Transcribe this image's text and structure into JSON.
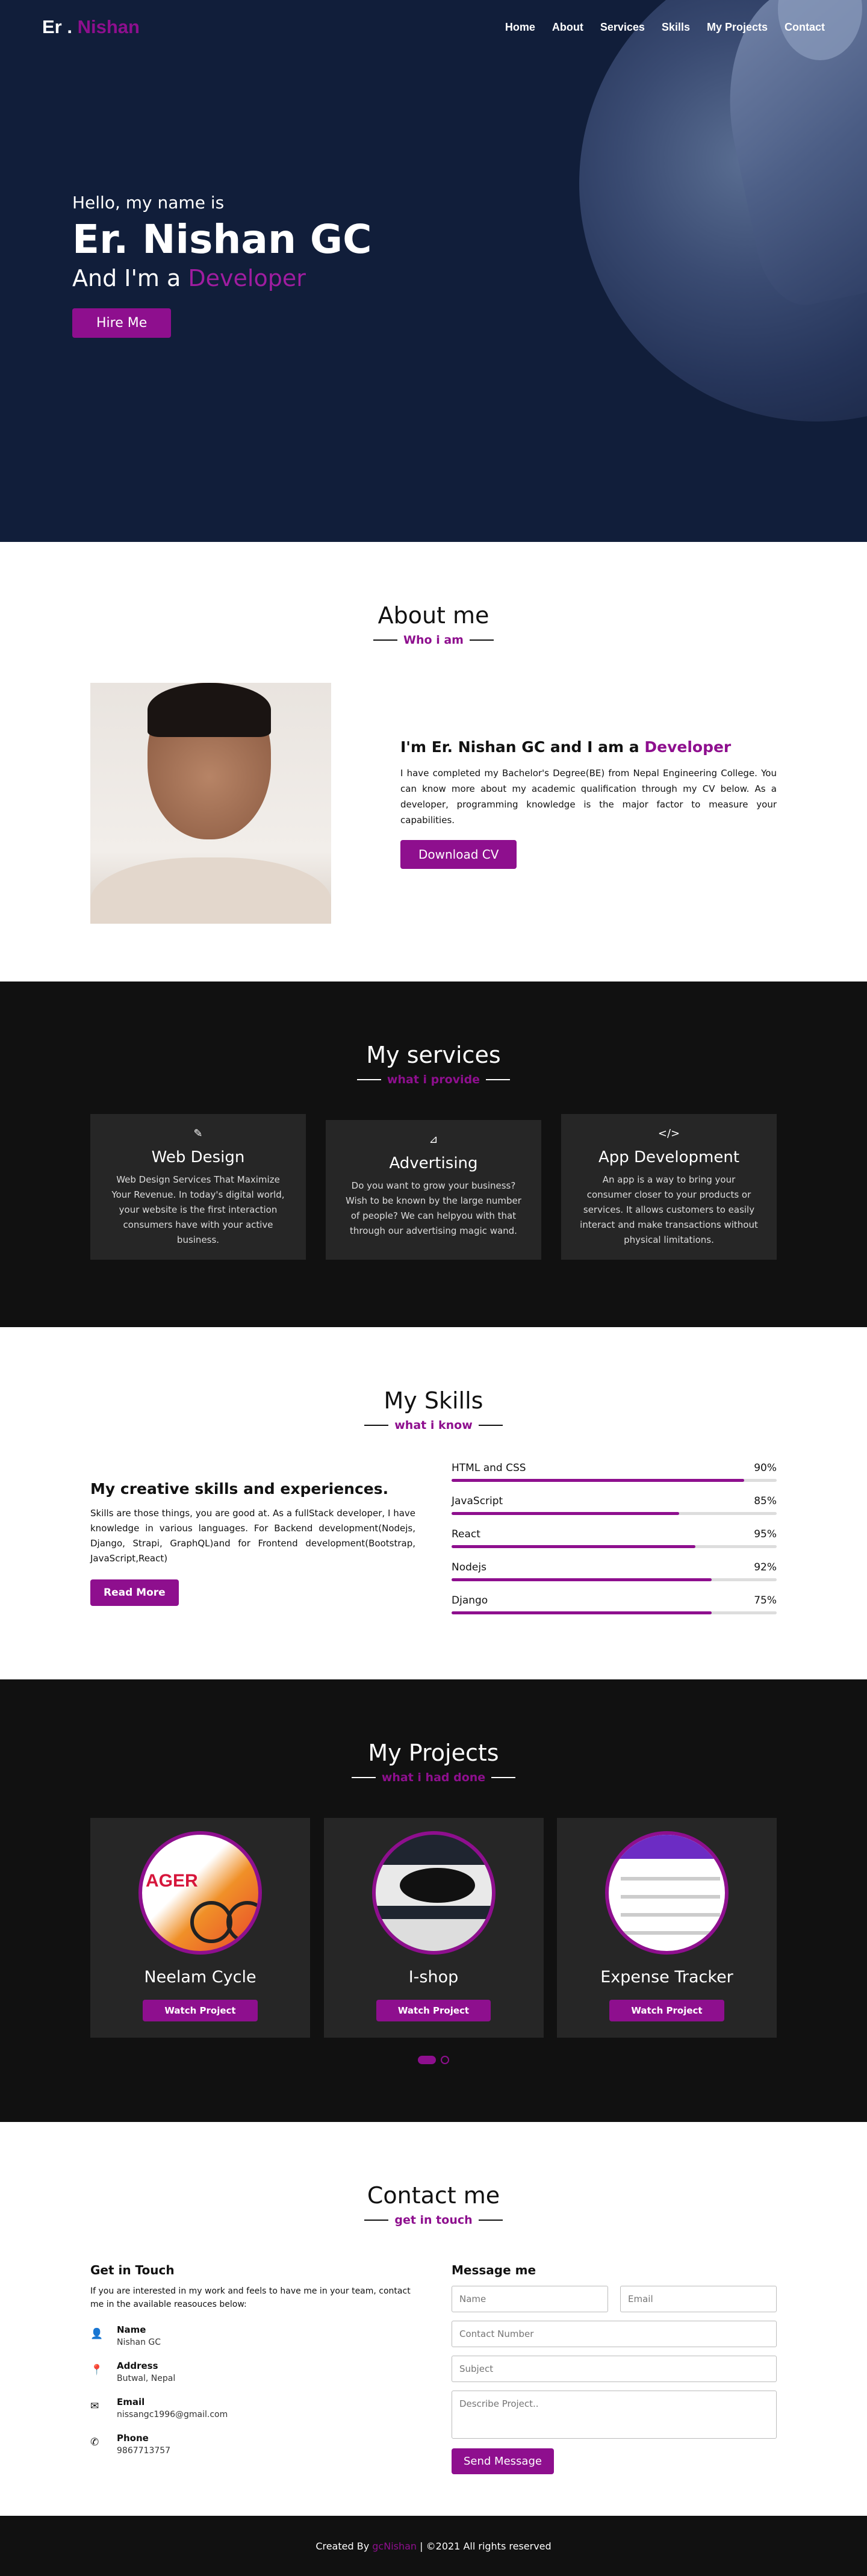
{
  "nav": {
    "logo_prefix": "Er .",
    "logo_name": "Nishan",
    "links": [
      "Home",
      "About",
      "Services",
      "Skills",
      "My Projects",
      "Contact"
    ]
  },
  "hero": {
    "hello": "Hello, my name is",
    "name": "Er. Nishan GC",
    "role_prefix": "And I'm a",
    "role": "Developer",
    "button": "Hire Me"
  },
  "about": {
    "title": "About me",
    "subtitle": "Who i am",
    "heading_prefix": "I'm Er. Nishan GC and I am a",
    "heading_role": "Developer",
    "paragraph": "I have completed my Bachelor's Degree(BE) from Nepal Engineering College. You can know more about my academic qualification through my CV below. As a developer, programming knowledge is the major factor to measure your capabilities.",
    "button": "Download CV"
  },
  "services": {
    "title": "My services",
    "subtitle": "what i provide",
    "cards": [
      {
        "icon": "brush-icon",
        "glyph": "✎",
        "title": "Web Design",
        "text": "Web Design Services That Maximize Your Revenue. In today's digital world, your website is the first interaction consumers have with your active business."
      },
      {
        "icon": "chart-icon",
        "glyph": "⊿",
        "title": "Advertising",
        "text": "Do you want to grow your business? Wish to be known by the large number of people? We can helpyou with that through our advertising magic wand."
      },
      {
        "icon": "code-icon",
        "glyph": "</>",
        "title": "App Development",
        "text": "An app is a way to bring your consumer closer to your products or services. It allows customers to easily interact and make transactions without physical limitations."
      }
    ]
  },
  "skills": {
    "title": "My Skills",
    "subtitle": "what i know",
    "heading": "My creative skills and experiences.",
    "paragraph": "Skills are those things, you are good at. As a fullStack developer, I have knowledge in various languages. For Backend development(Nodejs, Django, Strapi, GraphQL)and for Frontend development(Bootstrap, JavaScript,React)",
    "button": "Read More",
    "items": [
      {
        "name": "HTML and CSS",
        "label": "90%",
        "value": 0.9
      },
      {
        "name": "JavaScript",
        "label": "85%",
        "value": 0.7
      },
      {
        "name": "React",
        "label": "95%",
        "value": 0.75
      },
      {
        "name": "Nodejs",
        "label": "92%",
        "value": 0.8
      },
      {
        "name": "Django",
        "label": "75%",
        "value": 0.8
      }
    ]
  },
  "projects": {
    "title": "My Projects",
    "subtitle": "what i had done",
    "items": [
      {
        "title": "Neelam Cycle",
        "thumb_text": "AGER",
        "button": "Watch Project"
      },
      {
        "title": "I-shop",
        "button": "Watch Project"
      },
      {
        "title": "Expense Tracker",
        "button": "Watch Project"
      }
    ]
  },
  "contact": {
    "title": "Contact me",
    "subtitle": "get in touch",
    "left_heading": "Get in Touch",
    "intro": "If you are interested in my work and feels to have me in your team, contact me in the available reasouces below:",
    "items": [
      {
        "icon": "person-icon",
        "glyph": "👤",
        "label": "Name",
        "value": "Nishan GC"
      },
      {
        "icon": "map-pin-icon",
        "glyph": "📍",
        "label": "Address",
        "value": "Butwal, Nepal"
      },
      {
        "icon": "envelope-icon",
        "glyph": "✉",
        "label": "Email",
        "value": "nissangc1996@gmail.com"
      },
      {
        "icon": "phone-icon",
        "glyph": "✆",
        "label": "Phone",
        "value": "9867713757"
      }
    ],
    "form_heading": "Message me",
    "placeholders": {
      "name": "Name",
      "email": "Email",
      "number": "Contact Number",
      "subject": "Subject",
      "project": "Describe Project.."
    },
    "button": "Send Message"
  },
  "footer": {
    "prefix": "Created By",
    "author": "gcNishan",
    "suffix": "| ©2021 All rights reserved"
  },
  "colors": {
    "accent": "#8e0f8e",
    "hero_bg": "#111e3a",
    "dark_bg": "#111111",
    "card_bg": "#262626"
  }
}
